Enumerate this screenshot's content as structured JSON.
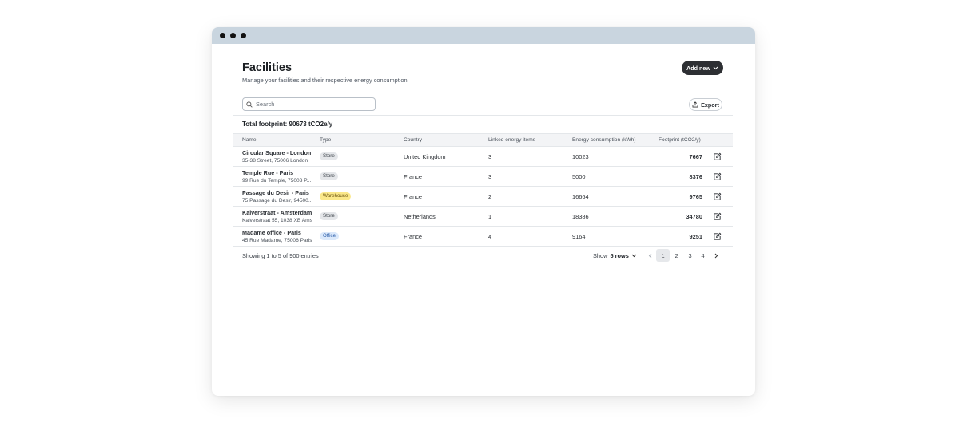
{
  "header": {
    "title": "Facilities",
    "subtitle": "Manage your facilities and their respective energy consumption",
    "add_new_label": "Add new"
  },
  "search": {
    "placeholder": "Search",
    "value": ""
  },
  "export_label": "Export",
  "total_footprint": "Total footprint: 90673 tCO2e/y",
  "table": {
    "columns": [
      "Name",
      "Type",
      "Country",
      "Linked energy items",
      "Energy consumption (kWh)",
      "Footprint (tCO2/y)"
    ],
    "rows": [
      {
        "name": "Circular Square - London",
        "address": "35-38 Street, 75006 London",
        "type": "Store",
        "type_style": "store",
        "country": "United Kingdom",
        "linked": "3",
        "energy": "10023",
        "footprint": "7667"
      },
      {
        "name": "Temple Rue - Paris",
        "address": "99 Rue du Temple, 75003 P...",
        "type": "Store",
        "type_style": "store",
        "country": "France",
        "linked": "3",
        "energy": "5000",
        "footprint": "8376"
      },
      {
        "name": "Passage du Desir - Paris",
        "address": "75 Passage du Desir, 94500...",
        "type": "Warehouse",
        "type_style": "warehouse",
        "country": "France",
        "linked": "2",
        "energy": "16664",
        "footprint": "9765"
      },
      {
        "name": "Kalverstraat - Amsterdam",
        "address": "Kalverstraat 55, 1038 XB Ams",
        "type": "Store",
        "type_style": "store",
        "country": "Netherlands",
        "linked": "1",
        "energy": "18386",
        "footprint": "34780"
      },
      {
        "name": "Madame office - Paris",
        "address": "45 Rue Madame, 75006 Paris",
        "type": "Office",
        "type_style": "office",
        "country": "France",
        "linked": "4",
        "energy": "9164",
        "footprint": "9251"
      }
    ]
  },
  "footer": {
    "showing": "Showing 1 to 5 of 900 entries",
    "show_label": "Show",
    "rows_value": "5 rows",
    "pages": [
      "1",
      "2",
      "3",
      "4"
    ],
    "active_page": "1"
  },
  "icons": {
    "search": "search-icon",
    "add_new_chevron": "chevron-down-icon",
    "export": "upload-icon",
    "edit": "edit-icon",
    "prev": "chevron-left-icon",
    "next": "chevron-right-icon"
  }
}
